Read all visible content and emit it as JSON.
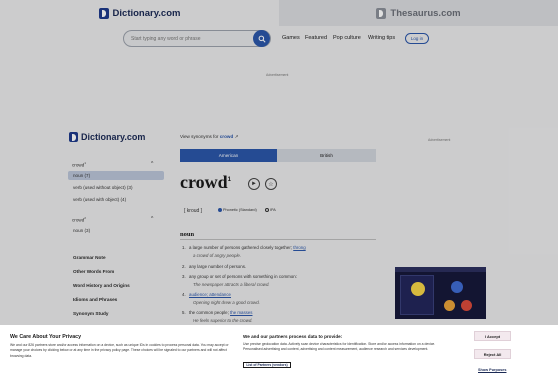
{
  "tabs": {
    "dictionary": "Dictionary.com",
    "thesaurus": "Thesaurus.com"
  },
  "search": {
    "placeholder": "Start typing any word or phrase"
  },
  "nav": {
    "games": "Games",
    "featured": "Featured",
    "pop_culture": "Pop culture",
    "writing_tips": "Writing tips",
    "login": "Log in"
  },
  "ads": {
    "top_label": "Advertisement",
    "side_label": "Advertisement"
  },
  "sidebar": {
    "logo": "Dictionary.com",
    "crowd1_word": "crowd",
    "crowd1_sup": "1",
    "crowd1_items": [
      {
        "label": "noun",
        "count": "(7)"
      },
      {
        "label": "verb (used without object)",
        "count": "(3)"
      },
      {
        "label": "verb (used with object)",
        "count": "(4)"
      }
    ],
    "crowd2_word": "crowd",
    "crowd2_sup": "2",
    "crowd2_items": [
      {
        "label": "noun",
        "count": "(3)"
      }
    ],
    "links": [
      "Grammar Note",
      "Other Words From",
      "Word History and Origins",
      "Idioms and Phrases",
      "Synonym Study"
    ]
  },
  "main": {
    "synonyms_prefix": "View synonyms for",
    "synonyms_word": "crowd",
    "tab_us": "American",
    "tab_uk": "British",
    "headword": "crowd",
    "headword_sup": "1",
    "pron": "[ kroud ]",
    "phonetic": "Phonetic (Standard)",
    "ipa": "IPA",
    "pos": "noun",
    "definitions": [
      {
        "num": "1.",
        "text": "a large number of persons gathered closely together;",
        "link": "throng",
        "example": "a crowd of angry people."
      },
      {
        "num": "2.",
        "text": "any large number of persons.",
        "link": "",
        "example": ""
      },
      {
        "num": "3.",
        "text": "any group or set of persons with something in common:",
        "link": "",
        "example": "The newspaper attracts a liberal crowd."
      },
      {
        "num": "4.",
        "text": "",
        "link": "audience; attendance",
        "example": "Opening night drew a good crowd."
      },
      {
        "num": "5.",
        "text": "the common people;",
        "link": "the masses",
        "example": "He feels superior to the crowd."
      }
    ]
  },
  "cookie": {
    "title": "We Care About Your Privacy",
    "body": "We and our 826 partners store and/or access information on a device, such as unique IDs in cookies to process personal data. You may accept or manage your choices by clicking below or at any time in the privacy policy page. These choices will be signaled to our partners and will not affect browsing data.",
    "title2": "We and our partners process data to provide:",
    "body2": "Use precise geolocation data. Actively scan device characteristics for identification. Store and/or access information on a device. Personalised advertising and content, advertising and content measurement, audience research and services development.",
    "vendors": "List of Partners (vendors)",
    "accept": "I Accept",
    "reject": "Reject All",
    "manage": "Show Purposes"
  },
  "colors": {
    "brand": "#2b56a8",
    "brand_dark": "#1b2a55"
  }
}
